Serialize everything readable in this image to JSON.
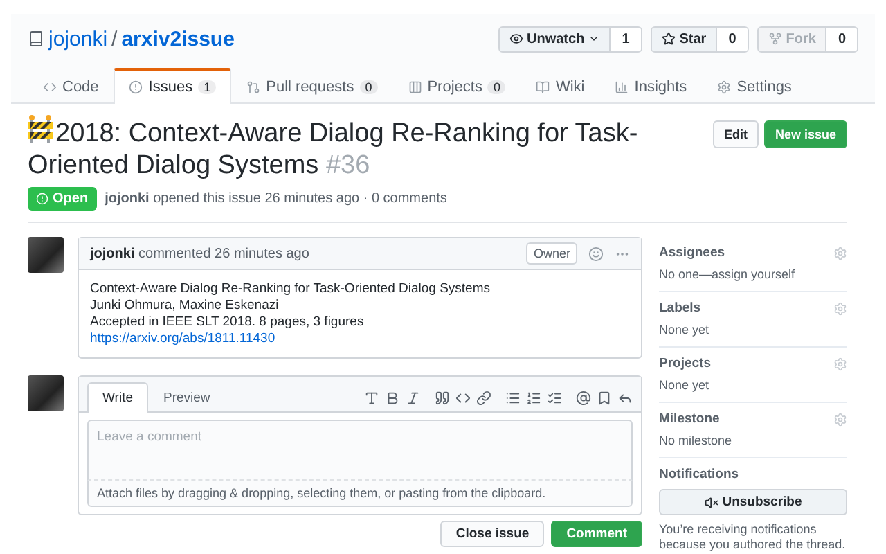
{
  "repo": {
    "owner": "jojonki",
    "separator": "/",
    "name": "arxiv2issue"
  },
  "repo_actions": [
    {
      "kind": "watch",
      "label": "Unwatch",
      "count": "1",
      "disabled": false
    },
    {
      "kind": "star",
      "label": "Star",
      "count": "0",
      "disabled": false
    },
    {
      "kind": "fork",
      "label": "Fork",
      "count": "0",
      "disabled": true
    }
  ],
  "tabs": [
    {
      "label": "Code",
      "selected": false
    },
    {
      "label": "Issues",
      "count": "1",
      "selected": true
    },
    {
      "label": "Pull requests",
      "count": "0",
      "selected": false
    },
    {
      "label": "Projects",
      "count": "0",
      "selected": false
    },
    {
      "label": "Wiki",
      "selected": false
    },
    {
      "label": "Insights",
      "selected": false
    },
    {
      "label": "Settings",
      "selected": false
    }
  ],
  "issue": {
    "title": "2018: Context-Aware Dialog Re-Ranking for Task-Oriented Dialog Systems",
    "number": "#36",
    "status": "Open",
    "author": "jojonki",
    "meta": "opened this issue 26 minutes ago · 0 comments"
  },
  "header_buttons": [
    {
      "label": "Edit",
      "primary": false
    },
    {
      "label": "New issue",
      "primary": true
    }
  ],
  "comment": {
    "author": "jojonki",
    "action": "commented 26 minutes ago",
    "role": "Owner",
    "body_lines": [
      "Context-Aware Dialog Re-Ranking for Task-Oriented Dialog Systems",
      "Junki Ohmura, Maxine Eskenazi",
      "Accepted in IEEE SLT 2018. 8 pages, 3 figures"
    ],
    "link": "https://arxiv.org/abs/1811.11430"
  },
  "composer": {
    "tabs": [
      {
        "label": "Write",
        "selected": true
      },
      {
        "label": "Preview",
        "selected": false
      }
    ],
    "placeholder": "Leave a comment",
    "attach_hint": "Attach files by dragging & dropping, selecting them, or pasting from the clipboard.",
    "buttons": [
      {
        "label": "Close issue",
        "primary": false
      },
      {
        "label": "Comment",
        "primary": true
      }
    ]
  },
  "sidebar": {
    "sections": [
      {
        "heading": "Assignees",
        "value": "No one—assign yourself"
      },
      {
        "heading": "Labels",
        "value": "None yet"
      },
      {
        "heading": "Projects",
        "value": "None yet"
      },
      {
        "heading": "Milestone",
        "value": "No milestone"
      }
    ],
    "notifications": {
      "heading": "Notifications",
      "button": "Unsubscribe",
      "note": "You’re receiving notifications because you authored the thread."
    }
  }
}
